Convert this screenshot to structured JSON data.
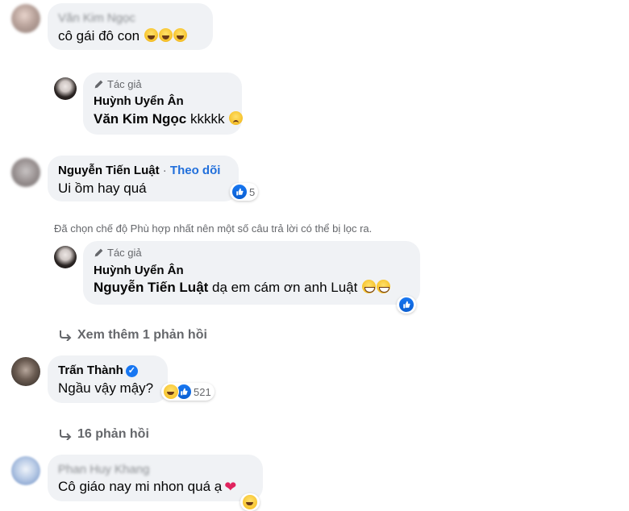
{
  "comments": [
    {
      "name": "Văn Kim Ngọc",
      "text": "cô gái đô con"
    },
    {
      "author_tag": "Tác giả",
      "name": "Huỳnh Uyển Ân",
      "mention": "Văn Kim Ngọc",
      "text": "kkkkk"
    },
    {
      "name": "Nguyễn Tiến Luật",
      "follow": "Theo dõi",
      "text": "Ui ồm hay quá",
      "reaction_count": "5"
    },
    {
      "author_tag": "Tác giả",
      "name": "Huỳnh Uyển Ân",
      "mention": "Nguyễn Tiến Luật",
      "text": "dạ em cám ơn anh Luật"
    },
    {
      "name": "Trấn Thành",
      "text": "Ngầu vậy mậy?",
      "reaction_count": "521"
    },
    {
      "name": "Phan Huy Khang",
      "text": "Cô giáo nay mi nhon quá ạ"
    }
  ],
  "filter_note": "Đã chọn chế độ Phù hợp nhất nên một số câu trả lời có thể bị lọc ra.",
  "view_more_replies": "Xem thêm 1 phản hồi",
  "replies_count": "16 phản hồi",
  "colors": {
    "bubble": "#f0f2f5",
    "link": "#216fdb",
    "muted": "#65676b",
    "like": "#1877f2"
  },
  "icons": [
    "pencil-icon",
    "verified-badge-icon",
    "like-icon",
    "haha-icon",
    "reply-arrow-icon",
    "heart-icon"
  ]
}
